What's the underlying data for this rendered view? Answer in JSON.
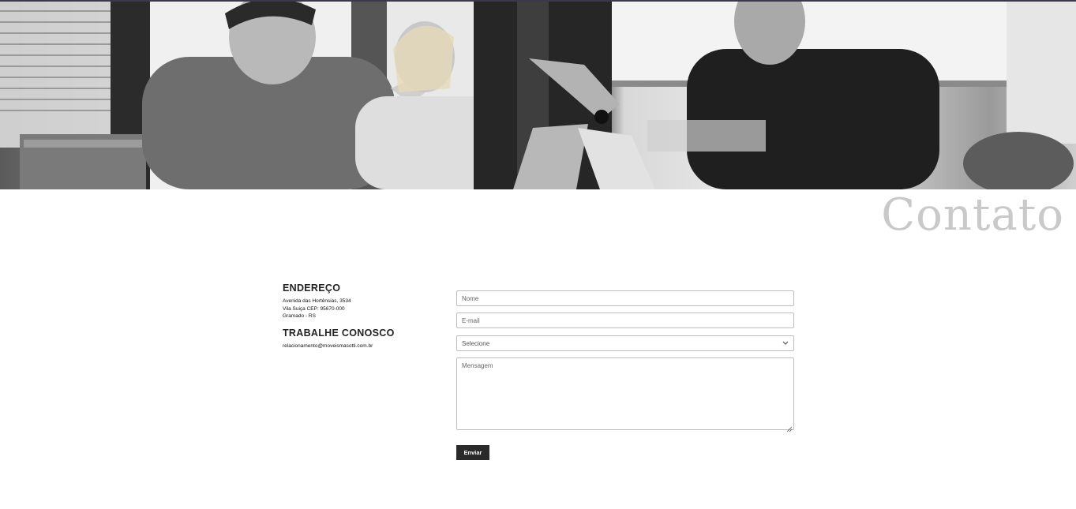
{
  "hero": {
    "image": "three-people-meeting-photo"
  },
  "page_title": "Contato",
  "address": {
    "heading": "ENDEREÇO",
    "lines": [
      "Avenida das Hortênsias, 3534",
      "Vila Suiça CEP: 95670-000",
      "Gramado - RS"
    ]
  },
  "careers": {
    "heading": "TRABALHE CONOSCO",
    "email": "relacionamento@moveismasotti.com.br"
  },
  "form": {
    "name_placeholder": "Nome",
    "email_placeholder": "E-mail",
    "select_value": "Selecione",
    "message_placeholder": "Mensagem",
    "submit_label": "Enviar"
  },
  "icons": {
    "select": "chevron-down-icon",
    "resize": "resize-grip-icon"
  }
}
